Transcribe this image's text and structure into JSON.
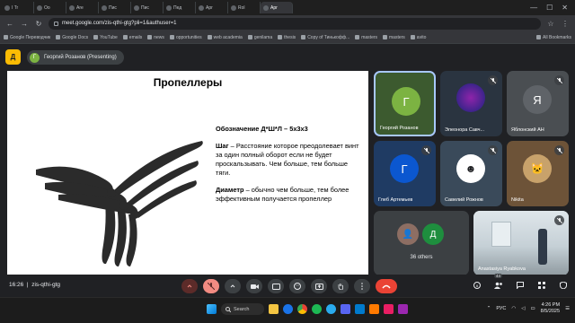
{
  "browser": {
    "tabs": [
      {
        "title": "I Tr",
        "active": false
      },
      {
        "title": "Oo",
        "active": false
      },
      {
        "title": "Are",
        "active": false
      },
      {
        "title": "Пис",
        "active": false
      },
      {
        "title": "Пис",
        "active": false
      },
      {
        "title": "Пед",
        "active": false
      },
      {
        "title": "Apr",
        "active": false
      },
      {
        "title": "Rol",
        "active": false
      },
      {
        "title": "Apr",
        "active": true
      }
    ],
    "url": "meet.google.com/zis-qthi-gtg?pli=1&authuser=1",
    "bookmarks": [
      "Google Переводчик",
      "Google Docs",
      "YouTube",
      "emails",
      "news",
      "opportunities",
      "web academia",
      "genilama",
      "thesis",
      "Copy of Тинькофф...",
      "masters",
      "masters",
      "avito"
    ],
    "all_bookmarks": "All Bookmarks"
  },
  "meet": {
    "logo_letter": "Д",
    "presenter_initial": "Г",
    "presenter_label": "Георгий Розанов (Presenting)",
    "slide": {
      "title": "Пропеллеры",
      "designation": "Обозначение Д*Ш*Л – 5х3х3",
      "step_term": "Шаг",
      "step_text": " – Расстояние которое преодолевает винт за один полный оборот если не будет проскальзывать. Чем больше, тем больше тяги.",
      "diameter_term": "Диаметр",
      "diameter_text": " – обычно чем больше, тем более эффективным получается пропеллер"
    },
    "participants": [
      {
        "name": "Георгий Розанов",
        "initial": "Г",
        "color": "#7cb342"
      },
      {
        "name": "Элеонора Савч...",
        "initial": "",
        "color": "#4a148c"
      },
      {
        "name": "Яблонский АН",
        "initial": "Я",
        "color": "#5f6368"
      },
      {
        "name": "Глеб Артемьев",
        "initial": "Г",
        "color": "#0b57d0"
      },
      {
        "name": "Савелий Рожнов",
        "initial": "",
        "color": "#ffffff"
      },
      {
        "name": "Nikita",
        "initial": "",
        "color": "#c8a26b"
      },
      {
        "name": "36 others",
        "initial": "Д",
        "color": "#1e8e3e"
      },
      {
        "name": "Anastasiya Ryabkova",
        "initial": "",
        "color": "#9e9e9e"
      }
    ],
    "meeting_time": "16:26",
    "meeting_code": "zis-qthi-gtg",
    "people_count": "44"
  },
  "taskbar": {
    "search_label": "Search",
    "lang": "РУС",
    "time": "4:26 PM",
    "date": "8/5/2025"
  }
}
